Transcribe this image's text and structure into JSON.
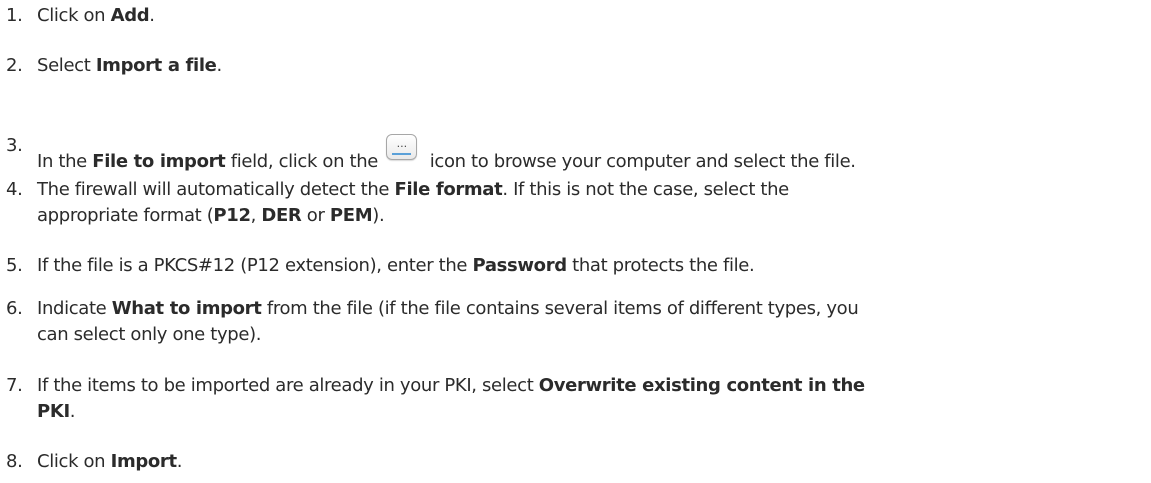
{
  "steps": [
    {
      "number": "1.",
      "parts": [
        "Click on ",
        "Add",
        "."
      ]
    },
    {
      "number": "2.",
      "parts": [
        "Select ",
        "Import a file",
        "."
      ]
    },
    {
      "number": "3.",
      "parts": [
        "In the ",
        "File to import",
        " field, click on the ",
        " icon to browse your computer and select the file."
      ],
      "icon": {
        "name": "browse-icon",
        "glyph": "..."
      }
    },
    {
      "number": "4.",
      "parts": [
        "The firewall will automatically detect the ",
        "File format",
        ". If this is not the case, select the"
      ],
      "continuation": [
        "appropriate format (",
        "P12",
        ", ",
        "DER",
        " or ",
        "PEM",
        ")."
      ]
    },
    {
      "number": "5.",
      "parts": [
        "If the file is a PKCS#12 (P12 extension), enter the ",
        "Password",
        " that protects the file."
      ]
    },
    {
      "number": "6.",
      "parts": [
        "Indicate ",
        "What to import",
        " from the file (if the file contains several items of different types, you"
      ],
      "continuation": [
        "can select only one type)."
      ]
    },
    {
      "number": "7.",
      "parts": [
        "If the items to be imported are already in your PKI, select ",
        "Overwrite existing content in the"
      ],
      "continuation": [
        "PKI",
        "."
      ]
    },
    {
      "number": "8.",
      "parts": [
        "Click on ",
        "Import",
        "."
      ]
    }
  ]
}
